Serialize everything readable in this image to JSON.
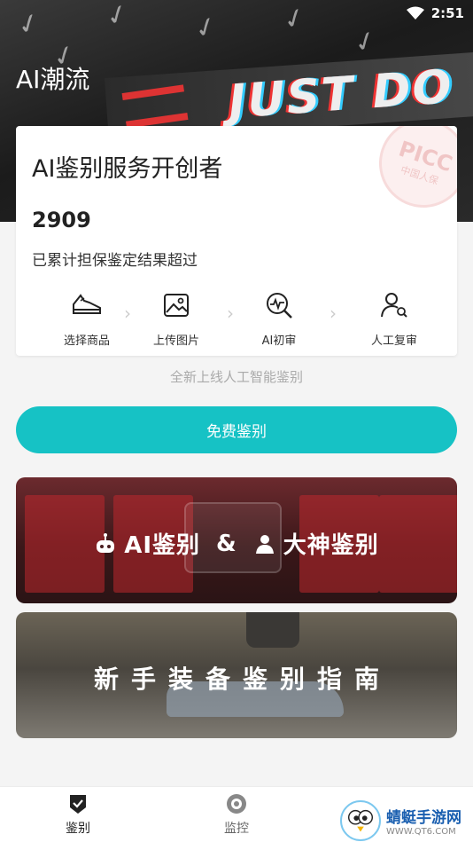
{
  "status_bar": {
    "time": "2:51"
  },
  "app": {
    "title": "AI潮流"
  },
  "summary_card": {
    "title": "AI鉴别服务开创者",
    "count": "2909",
    "subtitle": "已累计担保鉴定结果超过",
    "seal_text": "PICC",
    "seal_sub": "中国人保"
  },
  "steps": [
    {
      "label": "选择商品",
      "icon": "sneaker-icon"
    },
    {
      "label": "上传图片",
      "icon": "image-icon"
    },
    {
      "label": "AI初审",
      "icon": "ai-scan-icon"
    },
    {
      "label": "人工复审",
      "icon": "person-search-icon"
    }
  ],
  "tagline": "全新上线人工智能鉴别",
  "cta": {
    "label": "免费鉴别",
    "color": "#16c2c5"
  },
  "banners": [
    {
      "part1": "AI鉴别",
      "sep": "&",
      "part2": "大神鉴别"
    },
    {
      "text": "新手装备鉴别指南"
    }
  ],
  "hero_banner_text": "JUST DO IT",
  "tabs": [
    {
      "label": "鉴别",
      "icon": "shield-check-icon",
      "active": true
    },
    {
      "label": "监控",
      "icon": "radar-icon",
      "active": false
    }
  ],
  "watermark": {
    "main": "蜻蜓手游网",
    "url": "WWW.QT6.COM"
  }
}
